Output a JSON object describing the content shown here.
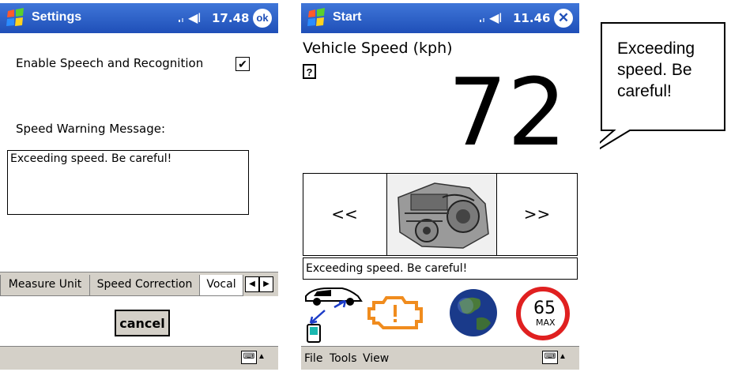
{
  "settings": {
    "title": "Settings",
    "clock": "17.48",
    "ok_label": "ok",
    "enable_label": "Enable Speech and Recognition",
    "enable_checked": true,
    "warning_label": "Speed Warning Message:",
    "warning_value": "Exceeding speed. Be careful!",
    "tabs": [
      "Measure Unit",
      "Speed Correction",
      "Vocal"
    ],
    "cancel_label": "cancel"
  },
  "start": {
    "title": "Start",
    "clock": "11.46",
    "speed_label": "Vehicle Speed (kph)",
    "help_label": "?",
    "speed_value": "72",
    "prev_label": "<<",
    "next_label": ">>",
    "status_text": "Exceeding speed. Be careful!",
    "menu": [
      "File",
      "Tools",
      "View"
    ],
    "limit_value": "65",
    "limit_label": "MAX"
  },
  "callout": {
    "lines": [
      "Exceeding",
      "speed. Be",
      "careful!"
    ]
  },
  "colors": {
    "titlebar": "#1f4fb8",
    "engine_warning": "#f08c1e",
    "limit_ring": "#e02020"
  }
}
